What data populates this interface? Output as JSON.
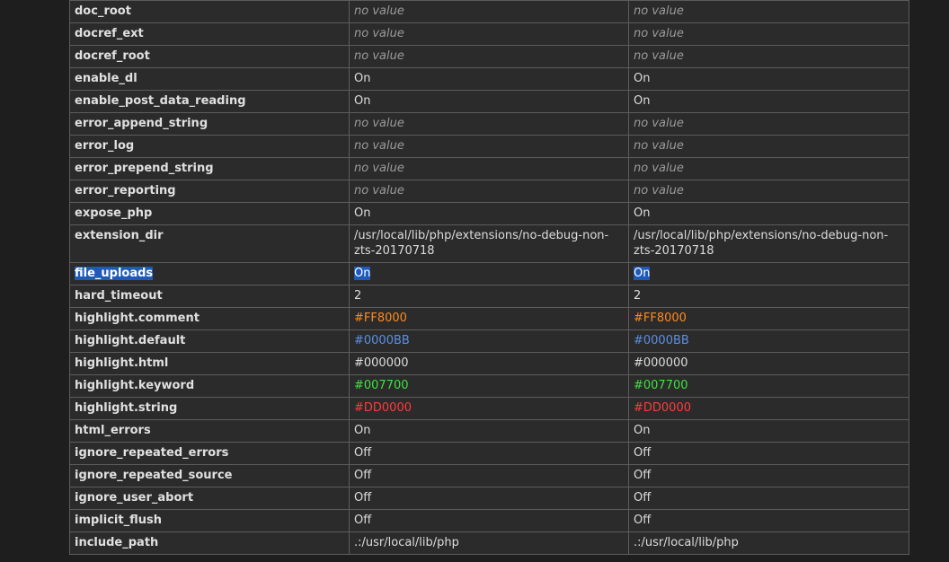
{
  "rows": [
    {
      "key": "doc_root",
      "local": "no value",
      "master": "no value",
      "style": "novalue"
    },
    {
      "key": "docref_ext",
      "local": "no value",
      "master": "no value",
      "style": "novalue"
    },
    {
      "key": "docref_root",
      "local": "no value",
      "master": "no value",
      "style": "novalue"
    },
    {
      "key": "enable_dl",
      "local": "On",
      "master": "On",
      "style": "plain"
    },
    {
      "key": "enable_post_data_reading",
      "local": "On",
      "master": "On",
      "style": "plain"
    },
    {
      "key": "error_append_string",
      "local": "no value",
      "master": "no value",
      "style": "novalue"
    },
    {
      "key": "error_log",
      "local": "no value",
      "master": "no value",
      "style": "novalue"
    },
    {
      "key": "error_prepend_string",
      "local": "no value",
      "master": "no value",
      "style": "novalue"
    },
    {
      "key": "error_reporting",
      "local": "no value",
      "master": "no value",
      "style": "novalue"
    },
    {
      "key": "expose_php",
      "local": "On",
      "master": "On",
      "style": "plain"
    },
    {
      "key": "extension_dir",
      "local": "/usr/local/lib/php/extensions/no-debug-non-zts-20170718",
      "master": "/usr/local/lib/php/extensions/no-debug-non-zts-20170718",
      "style": "plain"
    },
    {
      "key": "file_uploads",
      "local": "On",
      "master": "On",
      "style": "selected"
    },
    {
      "key": "hard_timeout",
      "local": "2",
      "master": "2",
      "style": "plain"
    },
    {
      "key": "highlight.comment",
      "local": "#FF8000",
      "master": "#FF8000",
      "style": "orange"
    },
    {
      "key": "highlight.default",
      "local": "#0000BB",
      "master": "#0000BB",
      "style": "blue"
    },
    {
      "key": "highlight.html",
      "local": "#000000",
      "master": "#000000",
      "style": "plain"
    },
    {
      "key": "highlight.keyword",
      "local": "#007700",
      "master": "#007700",
      "style": "green"
    },
    {
      "key": "highlight.string",
      "local": "#DD0000",
      "master": "#DD0000",
      "style": "red"
    },
    {
      "key": "html_errors",
      "local": "On",
      "master": "On",
      "style": "plain"
    },
    {
      "key": "ignore_repeated_errors",
      "local": "Off",
      "master": "Off",
      "style": "plain"
    },
    {
      "key": "ignore_repeated_source",
      "local": "Off",
      "master": "Off",
      "style": "plain"
    },
    {
      "key": "ignore_user_abort",
      "local": "Off",
      "master": "Off",
      "style": "plain"
    },
    {
      "key": "implicit_flush",
      "local": "Off",
      "master": "Off",
      "style": "plain"
    },
    {
      "key": "include_path",
      "local": ".:/usr/local/lib/php",
      "master": ".:/usr/local/lib/php",
      "style": "plain"
    }
  ],
  "colors": {
    "selection": "#1e5bb8",
    "orange": "#ff8a1f",
    "blue": "#5b8fe6",
    "green": "#3fe23f",
    "red": "#ff3b3b"
  }
}
